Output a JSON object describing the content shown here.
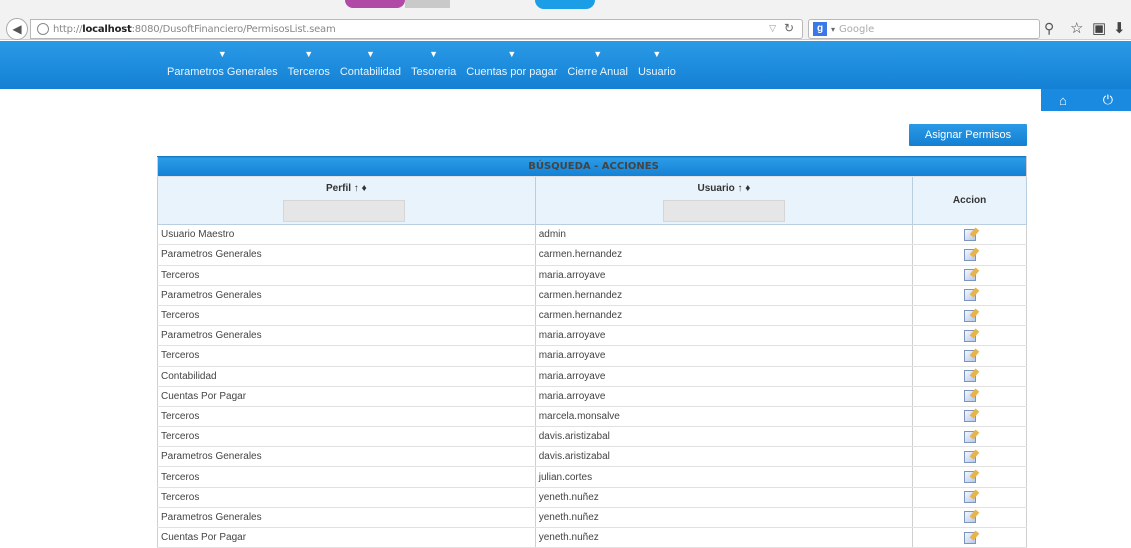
{
  "browser": {
    "url_prefix": "http://",
    "url_host": "localhost",
    "url_rest": ":8080/DusoftFinanciero/PermisosList.seam",
    "search_placeholder": "Google"
  },
  "nav": {
    "items": [
      {
        "label": "Parametros Generales"
      },
      {
        "label": "Terceros"
      },
      {
        "label": "Contabilidad"
      },
      {
        "label": "Tesoreria"
      },
      {
        "label": "Cuentas por pagar"
      },
      {
        "label": "Cierre Anual"
      },
      {
        "label": "Usuario"
      }
    ]
  },
  "actions": {
    "assign_label": "Asignar Permisos"
  },
  "grid": {
    "title": "BÚSQUEDA - ACCIONES",
    "col_perfil": "Perfil ↑",
    "col_usuario": "Usuario ↑",
    "col_accion": "Accion",
    "rows": [
      {
        "perfil": "Usuario Maestro",
        "usuario": "admin"
      },
      {
        "perfil": "Parametros Generales",
        "usuario": "carmen.hernandez"
      },
      {
        "perfil": "Terceros",
        "usuario": "maria.arroyave"
      },
      {
        "perfil": "Parametros Generales",
        "usuario": "carmen.hernandez"
      },
      {
        "perfil": "Terceros",
        "usuario": "carmen.hernandez"
      },
      {
        "perfil": "Parametros Generales",
        "usuario": "maria.arroyave"
      },
      {
        "perfil": "Terceros",
        "usuario": "maria.arroyave"
      },
      {
        "perfil": "Contabilidad",
        "usuario": "maria.arroyave"
      },
      {
        "perfil": "Cuentas Por Pagar",
        "usuario": "maria.arroyave"
      },
      {
        "perfil": "Terceros",
        "usuario": "marcela.monsalve"
      },
      {
        "perfil": "Terceros",
        "usuario": "davis.aristizabal"
      },
      {
        "perfil": "Parametros Generales",
        "usuario": "davis.aristizabal"
      },
      {
        "perfil": "Terceros",
        "usuario": "julian.cortes"
      },
      {
        "perfil": "Terceros",
        "usuario": "yeneth.nuñez"
      },
      {
        "perfil": "Parametros Generales",
        "usuario": "yeneth.nuñez"
      },
      {
        "perfil": "Cuentas Por Pagar",
        "usuario": "yeneth.nuñez"
      }
    ]
  }
}
